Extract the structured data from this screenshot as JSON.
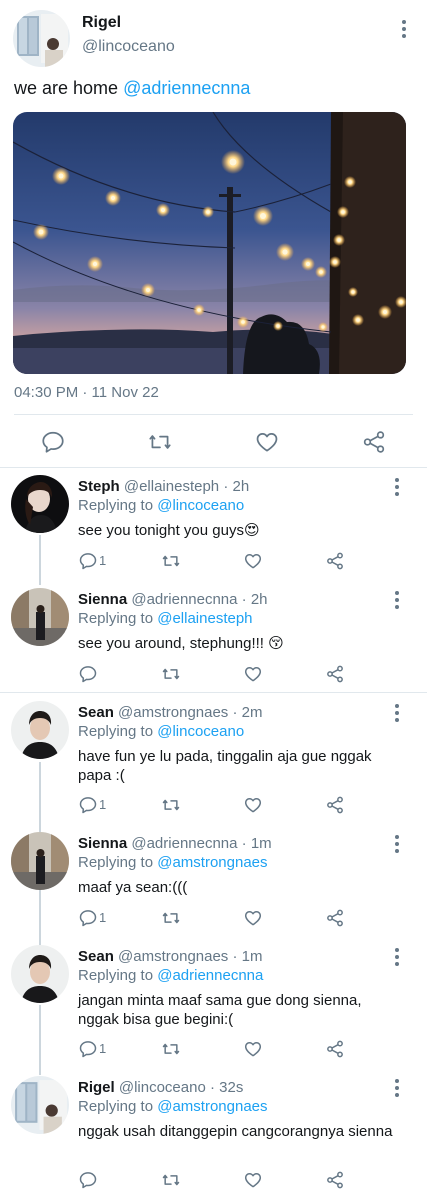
{
  "main_tweet": {
    "name": "Rigel",
    "handle": "@lincoceano",
    "text": "we are home",
    "mention": "@adriennecnna",
    "timestamp": "04:30 PM · 11 Nov 22",
    "icons": [
      "reply-icon",
      "retweet-icon",
      "like-icon",
      "share-icon",
      "more-icon"
    ]
  },
  "replies": [
    {
      "name": "Steph",
      "handle": "@ellainesteph",
      "time": "· 2h",
      "replying_label": "Replying to",
      "replying_to": "@lincoceano",
      "text": "see you tonight you guys",
      "emoji": "😍",
      "reply_count": "1"
    },
    {
      "name": "Sienna",
      "handle": "@adriennecnna",
      "time": "· 2h",
      "replying_label": "Replying to",
      "replying_to": "@ellainesteph",
      "text": "see you around, stephung!!!",
      "emoji": "😚",
      "reply_count": ""
    },
    {
      "name": "Sean",
      "handle": "@amstrongnaes",
      "time": "· 2m",
      "replying_label": "Replying to",
      "replying_to": "@lincoceano",
      "text": "have fun ye lu pada, tinggalin aja gue nggak papa :(",
      "emoji": "",
      "reply_count": "1"
    },
    {
      "name": "Sienna",
      "handle": "@adriennecnna",
      "time": "· 1m",
      "replying_label": "Replying to",
      "replying_to": "@amstrongnaes",
      "text": "maaf ya sean:(((",
      "emoji": "",
      "reply_count": "1"
    },
    {
      "name": "Sean",
      "handle": "@amstrongnaes",
      "time": "· 1m",
      "replying_label": "Replying to",
      "replying_to": "@adriennecnna",
      "text": "jangan minta maaf sama gue dong sienna, nggak bisa gue begini:(",
      "emoji": "",
      "reply_count": "1"
    },
    {
      "name": "Rigel",
      "handle": "@lincoceano",
      "time": "· 32s",
      "replying_label": "Replying to",
      "replying_to": "@amstrongnaes",
      "text": "nggak usah ditanggepin cangcorangnya sienna",
      "emoji": "",
      "reply_count": ""
    }
  ],
  "colors": {
    "accent": "#1da1f2",
    "secondary_text": "#657786",
    "divider": "#e1e8ed"
  }
}
